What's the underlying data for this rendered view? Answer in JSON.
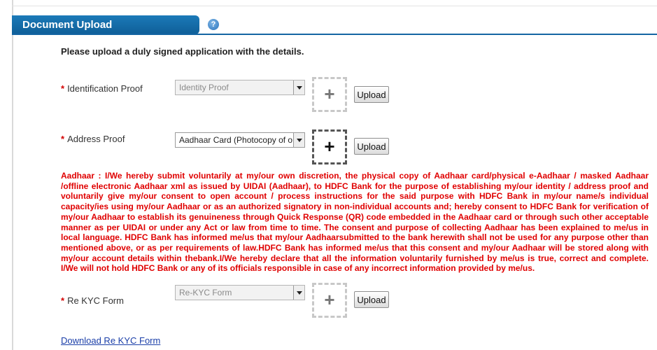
{
  "section": {
    "title": "Document Upload",
    "help_icon": "?",
    "instructions": "Please upload a duly signed application with the details."
  },
  "fields": {
    "identification": {
      "required_mark": "*",
      "label": "Identification Proof",
      "select_value": "Identity Proof",
      "add_glyph": "+",
      "upload_label": "Upload"
    },
    "address": {
      "required_mark": "*",
      "label": "Address Proof",
      "select_value": "Aadhaar Card (Photocopy of original)",
      "add_glyph": "+",
      "upload_label": "Upload"
    },
    "rekyc": {
      "required_mark": "*",
      "label": "Re KYC Form",
      "select_value": "Re-KYC Form",
      "add_glyph": "+",
      "upload_label": "Upload"
    }
  },
  "disclaimer": "Aadhaar : I/We hereby submit voluntarily at my/our own discretion, the physical copy of Aadhaar card/physical e-Aadhaar / masked Aadhaar /offline electronic Aadhaar xml as issued by UIDAI (Aadhaar), to HDFC Bank for the purpose of establishing my/our identity / address proof and voluntarily give my/our consent to open account / process instructions for the said purpose with HDFC Bank in my/our name/s individual capacity/ies using my/our Aadhaar or as an authorized signatory in non-individual accounts and; hereby consent to HDFC Bank for verification of my/our Aadhaar to establish its genuineness through Quick Response (QR) code embedded in the Aadhaar card or through such other acceptable manner as per UIDAI or under any Act or law from time to time. The consent and purpose of collecting Aadhaar has been explained to me/us in local language. HDFC Bank has informed me/us that my/our Aadhaarsubmitted to the bank herewith shall not be used for any purpose other than mentioned above, or as per requirements of law.HDFC Bank has informed me/us that this consent and my/our Aadhaar will be stored along with my/our account details within thebank.I/We hereby declare that all the information voluntarily furnished by me/us is true, correct and complete. I/We will not hold HDFC Bank or any of its officials responsible in case of any incorrect information provided by me/us.",
  "download_link": "Download Re KYC Form",
  "colors": {
    "header_bg": "#1570ad",
    "disclaimer_text": "#e00000",
    "required_mark": "#d40000",
    "link": "#1a3ea8"
  }
}
